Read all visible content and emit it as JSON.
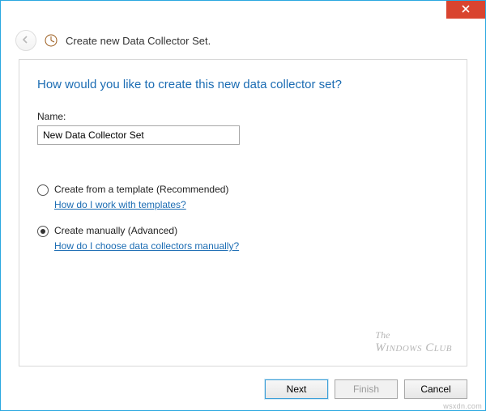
{
  "window": {
    "title": "Create new Data Collector Set."
  },
  "wizard": {
    "question": "How would you like to create this new data collector set?",
    "name_label": "Name:",
    "name_value": "New Data Collector Set",
    "options": {
      "template": {
        "label": "Create from a template (Recommended)",
        "help": "How do I work with templates?",
        "selected": false
      },
      "manual": {
        "label": "Create manually (Advanced)",
        "help": "How do I choose data collectors manually?",
        "selected": true
      }
    }
  },
  "buttons": {
    "next": "Next",
    "finish": "Finish",
    "cancel": "Cancel"
  },
  "watermark": {
    "line1": "The",
    "line2": "Windows Club"
  },
  "credit": "wsxdn.com"
}
